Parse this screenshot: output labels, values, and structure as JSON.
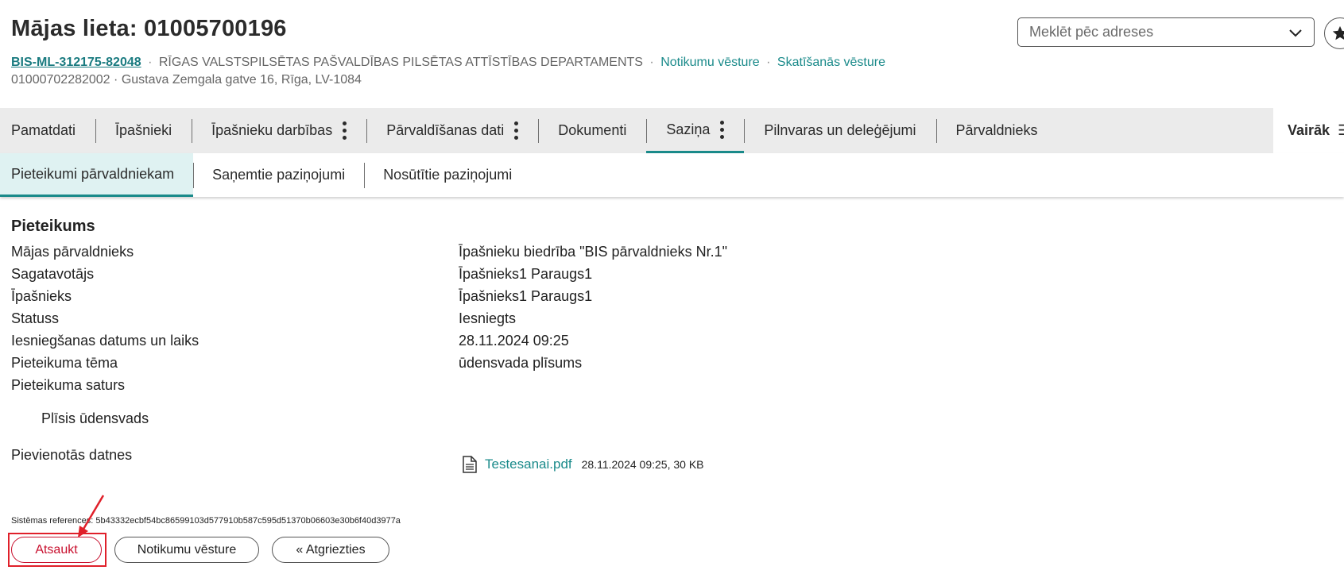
{
  "header": {
    "title": "Mājas lieta: 01005700196",
    "case_id": "BIS-ML-312175-82048",
    "department": "RĪGAS VALSTSPILSĒTAS PAŠVALDĪBAS PILSĒTAS ATTĪSTĪBAS DEPARTAMENTS",
    "separator": "·",
    "events_link": "Notikumu vēsture",
    "views_link": "Skatīšanās vēsture",
    "cadastre": "01000702282002",
    "address": "Gustava Zemgala gatve 16, Rīga, LV-1084"
  },
  "search": {
    "placeholder": "Meklēt pēc adreses"
  },
  "tabs": [
    {
      "label": "Pamatdati"
    },
    {
      "label": "Īpašnieki"
    },
    {
      "label": "Īpašnieku darbības"
    },
    {
      "label": "Pārvaldīšanas dati"
    },
    {
      "label": "Dokumenti"
    },
    {
      "label": "Saziņa"
    },
    {
      "label": "Pilnvaras un deleģējumi"
    },
    {
      "label": "Pārvaldnieks"
    }
  ],
  "more_tab": {
    "label": "Vairāk",
    "icon": "menu-icon"
  },
  "subtabs": [
    {
      "label": "Pieteikumi pārvaldniekam"
    },
    {
      "label": "Saņemtie paziņojumi"
    },
    {
      "label": "Nosūtītie paziņojumi"
    }
  ],
  "section": {
    "title": "Pieteikums"
  },
  "details": [
    {
      "label": "Mājas pārvaldnieks",
      "value": "Īpašnieku biedrība \"BIS pārvaldnieks Nr.1\""
    },
    {
      "label": "Sagatavotājs",
      "value": "Īpašnieks1 Paraugs1"
    },
    {
      "label": "Īpašnieks",
      "value": "Īpašnieks1 Paraugs1"
    },
    {
      "label": "Statuss",
      "value": "Iesniegts"
    },
    {
      "label": "Iesniegšanas datums un laiks",
      "value": "28.11.2024 09:25"
    },
    {
      "label": "Pieteikuma tēma",
      "value": "ūdensvada plīsums"
    },
    {
      "label": "Pieteikuma saturs",
      "value": ""
    }
  ],
  "content_text": "Plīsis ūdensvads",
  "attachments": {
    "label": "Pievienotās datnes",
    "file_name": "Testesanai.pdf",
    "file_meta": "28.11.2024 09:25, 30 KB",
    "icon": "document-icon"
  },
  "system_reference": "Sistēmas references: 5b43332ecbf54bc86599103d577910b587c595d51370b06603e30b6f40d3977a",
  "buttons": {
    "cancel": "Atsaukt",
    "history": "Notikumu vēsture",
    "back": "« Atgriezties"
  },
  "colors": {
    "accent": "#1a8a8a",
    "cancel": "#c8102e",
    "annotation": "#e0202a"
  }
}
